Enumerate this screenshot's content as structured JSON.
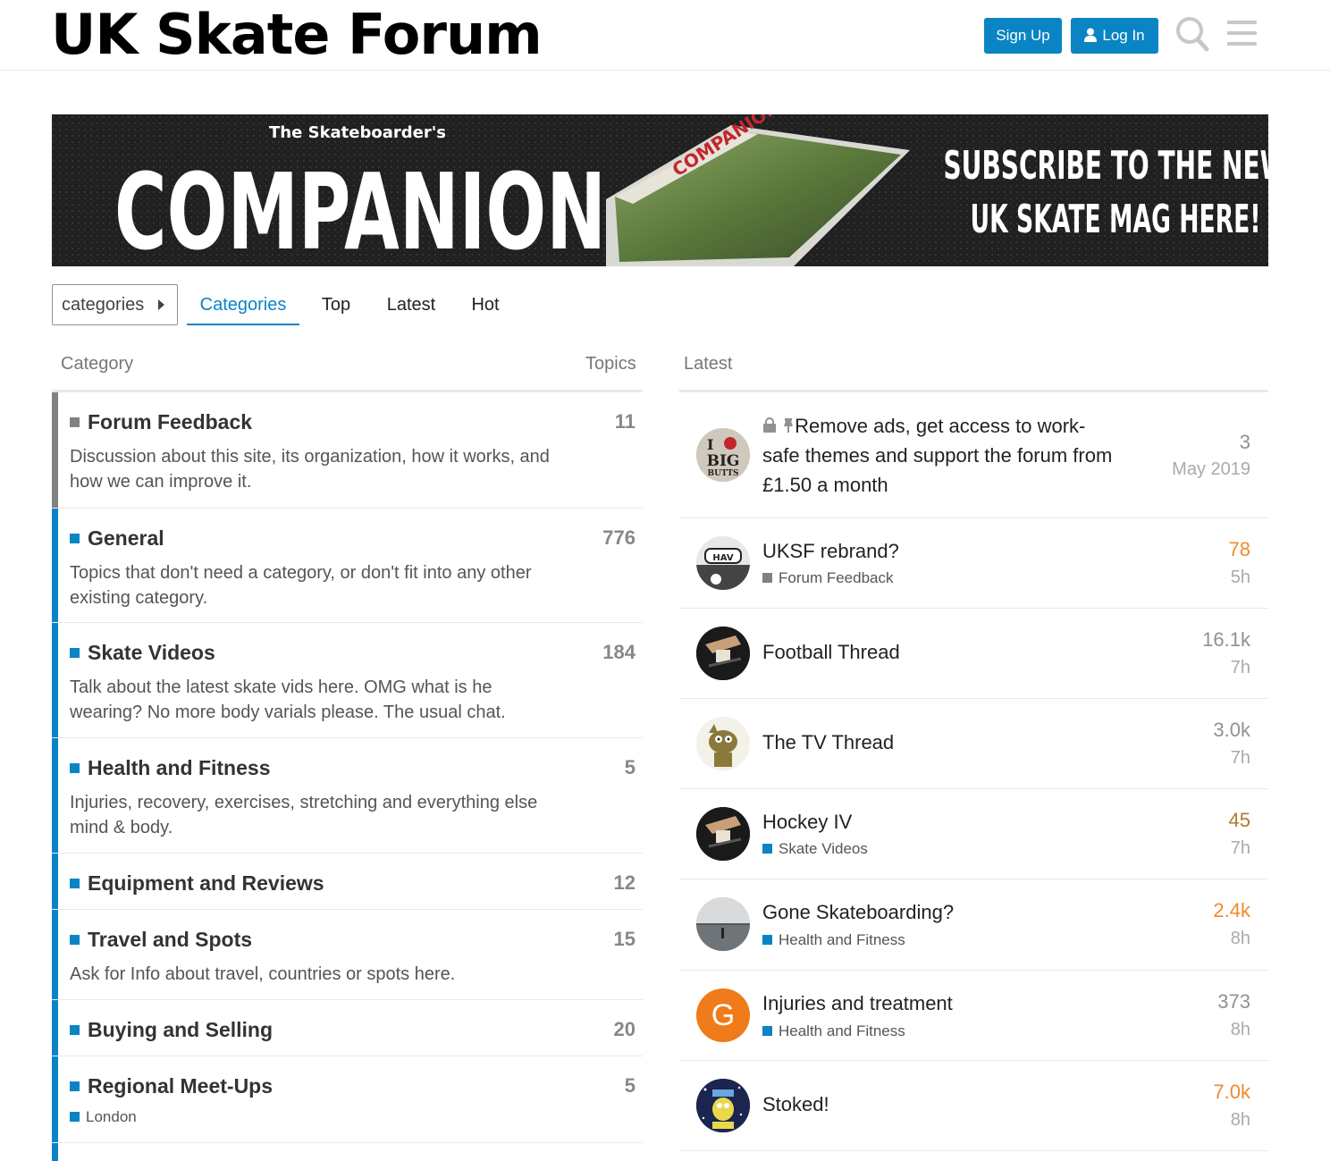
{
  "header": {
    "site_title": "UK Skate Forum",
    "signup_label": "Sign Up",
    "login_label": "Log In"
  },
  "banner": {
    "top_text": "The Skateboarder's",
    "main_text": "COMPANION",
    "cta_line1": "SUBSCRIBE TO THE NEW",
    "cta_line2": "UK SKATE MAG HERE!"
  },
  "nav": {
    "dropdown_label": "categories",
    "tabs": [
      "Categories",
      "Top",
      "Latest",
      "Hot"
    ],
    "active_tab": "Categories"
  },
  "columns": {
    "category": "Category",
    "topics": "Topics",
    "latest": "Latest"
  },
  "categories": [
    {
      "name": "Forum Feedback",
      "topics": "11",
      "description": "Discussion about this site, its organization, how it works, and how we can improve it.",
      "color": "#808281"
    },
    {
      "name": "General",
      "topics": "776",
      "description": "Topics that don't need a category, or don't fit into any other existing category.",
      "color": "#0a84c4"
    },
    {
      "name": "Skate Videos",
      "topics": "184",
      "description": "Talk about the latest skate vids here. OMG what is he wearing? No more body varials please. The usual chat.",
      "color": "#0a84c4"
    },
    {
      "name": "Health and Fitness",
      "topics": "5",
      "description": "Injuries, recovery, exercises, stretching and everything else mind & body.",
      "color": "#0a84c4"
    },
    {
      "name": "Equipment and Reviews",
      "topics": "12",
      "description": "",
      "color": "#0a84c4"
    },
    {
      "name": "Travel and Spots",
      "topics": "15",
      "description": "Ask for Info about travel, countries or spots here.",
      "color": "#0a84c4"
    },
    {
      "name": "Buying and Selling",
      "topics": "20",
      "description": "",
      "color": "#0a84c4"
    },
    {
      "name": "Regional Meet-Ups",
      "topics": "5",
      "description": "",
      "color": "#0a84c4",
      "subcategory": "London"
    }
  ],
  "latest": [
    {
      "title": "Remove ads, get access to work-safe themes and support the forum from £1.50 a month",
      "category": "",
      "posts": "3",
      "time": "May 2019",
      "posts_color": "#919191",
      "pinned": true
    },
    {
      "title": "UKSF rebrand?",
      "category": "Forum Feedback",
      "category_color": "#808281",
      "posts": "78",
      "time": "5h",
      "posts_color": "#f08a28"
    },
    {
      "title": "Football Thread",
      "category": "",
      "posts": "16.1k",
      "time": "7h",
      "posts_color": "#919191"
    },
    {
      "title": "The TV Thread",
      "category": "",
      "posts": "3.0k",
      "time": "7h",
      "posts_color": "#919191"
    },
    {
      "title": "Hockey IV",
      "category": "Skate Videos",
      "category_color": "#0a84c4",
      "posts": "45",
      "time": "7h",
      "posts_color": "#b07a30"
    },
    {
      "title": "Gone Skateboarding?",
      "category": "Health and Fitness",
      "category_color": "#0a84c4",
      "posts": "2.4k",
      "time": "8h",
      "posts_color": "#f08a28"
    },
    {
      "title": "Injuries and treatment",
      "category": "Health and Fitness",
      "category_color": "#0a84c4",
      "posts": "373",
      "time": "8h",
      "posts_color": "#919191",
      "avatar_letter": "G"
    },
    {
      "title": "Stoked!",
      "category": "",
      "posts": "7.0k",
      "time": "8h",
      "posts_color": "#f08a28"
    }
  ]
}
